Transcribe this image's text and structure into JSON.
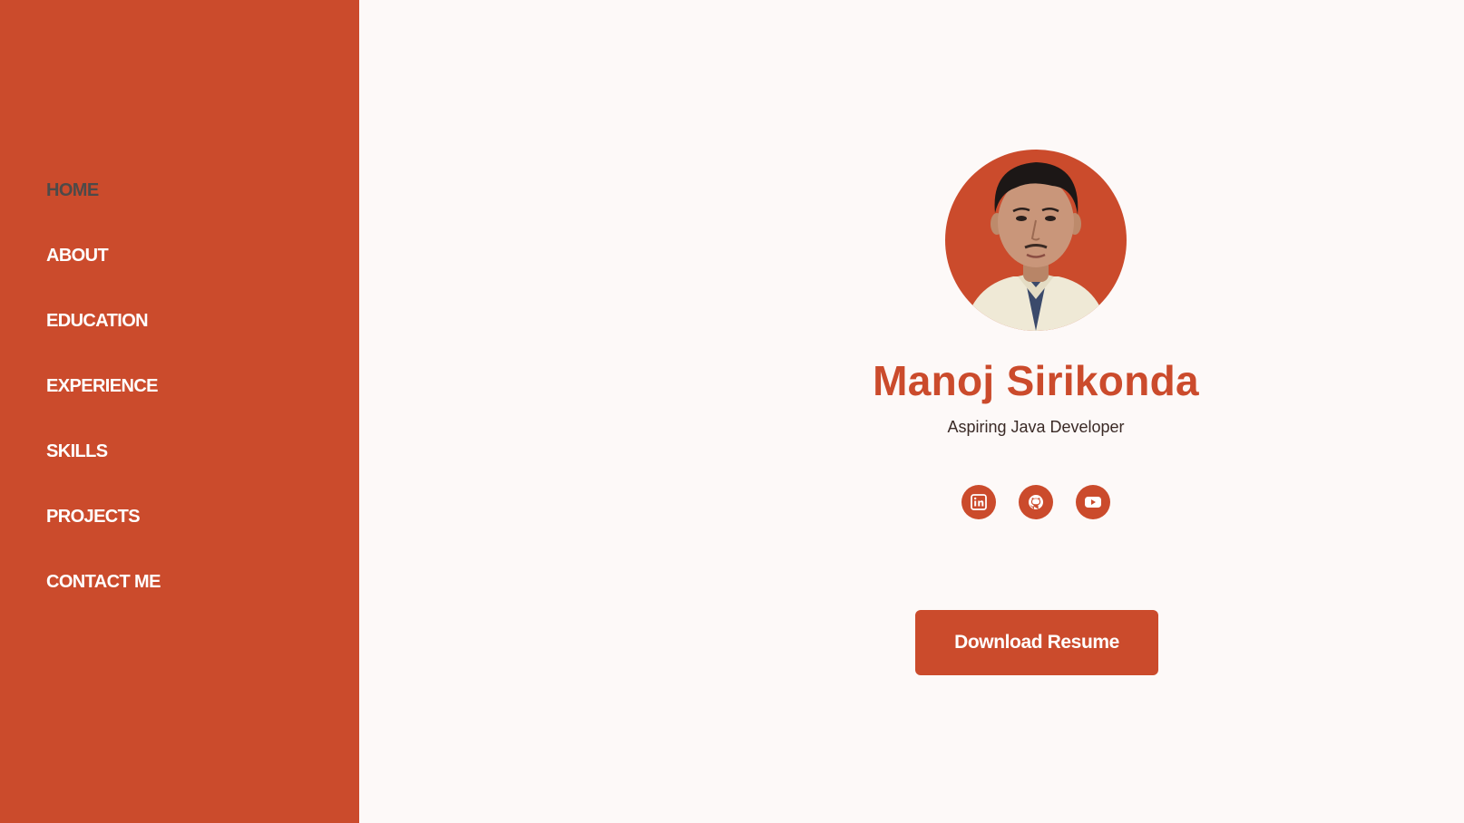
{
  "colors": {
    "accent": "#cb4b2c",
    "background": "#fdf9f8",
    "nav_active": "#4d4a49"
  },
  "sidebar": {
    "items": [
      {
        "label": "HOME",
        "active": true
      },
      {
        "label": "ABOUT"
      },
      {
        "label": "EDUCATION"
      },
      {
        "label": "EXPERIENCE"
      },
      {
        "label": "SKILLS"
      },
      {
        "label": "PROJECTS"
      },
      {
        "label": "CONTACT ME"
      }
    ]
  },
  "profile": {
    "name": "Manoj Sirikonda",
    "role": "Aspiring Java Developer",
    "socials": [
      {
        "icon": "linkedin-icon"
      },
      {
        "icon": "github-icon"
      },
      {
        "icon": "youtube-icon"
      }
    ],
    "download_label": "Download Resume"
  }
}
